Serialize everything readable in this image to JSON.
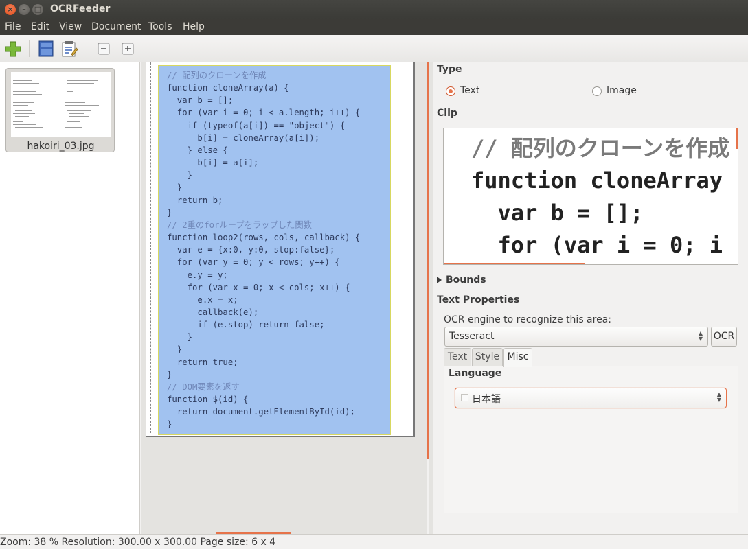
{
  "window": {
    "title": "OCRFeeder"
  },
  "menubar": {
    "items": [
      "File",
      "Edit",
      "View",
      "Document",
      "Tools",
      "Help"
    ]
  },
  "toolbar": {
    "icons": [
      "add-image-icon",
      "detect-icon",
      "properties-icon",
      "zoom-out-icon",
      "zoom-in-icon"
    ]
  },
  "pages_panel": {
    "items": [
      {
        "label": "hakoiri_03.jpg"
      }
    ]
  },
  "editor": {
    "code_lines": [
      {
        "text": "// 配列のクローンを作成",
        "comment": true
      },
      {
        "text": "function cloneArray(a) {",
        "comment": false
      },
      {
        "text": "  var b = [];",
        "comment": false
      },
      {
        "text": "  for (var i = 0; i < a.length; i++) {",
        "comment": false
      },
      {
        "text": "    if (typeof(a[i]) == \"object\") {",
        "comment": false
      },
      {
        "text": "      b[i] = cloneArray(a[i]);",
        "comment": false
      },
      {
        "text": "    } else {",
        "comment": false
      },
      {
        "text": "      b[i] = a[i];",
        "comment": false
      },
      {
        "text": "    }",
        "comment": false
      },
      {
        "text": "  }",
        "comment": false
      },
      {
        "text": "  return b;",
        "comment": false
      },
      {
        "text": "}",
        "comment": false
      },
      {
        "text": "// 2重のforループをラップした関数",
        "comment": true
      },
      {
        "text": "function loop2(rows, cols, callback) {",
        "comment": false
      },
      {
        "text": "  var e = {x:0, y:0, stop:false};",
        "comment": false
      },
      {
        "text": "  for (var y = 0; y < rows; y++) {",
        "comment": false
      },
      {
        "text": "    e.y = y;",
        "comment": false
      },
      {
        "text": "    for (var x = 0; x < cols; x++) {",
        "comment": false
      },
      {
        "text": "      e.x = x;",
        "comment": false
      },
      {
        "text": "      callback(e);",
        "comment": false
      },
      {
        "text": "      if (e.stop) return false;",
        "comment": false
      },
      {
        "text": "    }",
        "comment": false
      },
      {
        "text": "  }",
        "comment": false
      },
      {
        "text": "  return true;",
        "comment": false
      },
      {
        "text": "}",
        "comment": false
      },
      {
        "text": "// DOM要素を返す",
        "comment": true
      },
      {
        "text": "function $(id) {",
        "comment": false
      },
      {
        "text": "  return document.getElementById(id);",
        "comment": false
      },
      {
        "text": "}",
        "comment": false
      }
    ]
  },
  "properties": {
    "type_header": "Type",
    "type_options": {
      "text": "Text",
      "image": "Image",
      "selected": "Text"
    },
    "clip_header": "Clip",
    "clip_lines": [
      "// 配列のクローンを作成",
      "function cloneArray",
      "  var b = [];",
      "  for (var i = 0; i"
    ],
    "bounds_header": "Bounds",
    "text_properties_header": "Text Properties",
    "engine_label": "OCR engine to recognize this area:",
    "engine_value": "Tesseract",
    "ocr_button": "OCR",
    "tabs": [
      "Text",
      "Style",
      "Misc"
    ],
    "active_tab": "Misc",
    "language_header": "Language",
    "language_value": "日本語"
  },
  "statusbar": {
    "text": "Zoom: 38 % Resolution: 300.00 x 300.00 Page size: 6 x 4"
  },
  "colors": {
    "accent": "#e6734a",
    "selection": "#a1c2f0",
    "menubar": "#3c3b37"
  }
}
